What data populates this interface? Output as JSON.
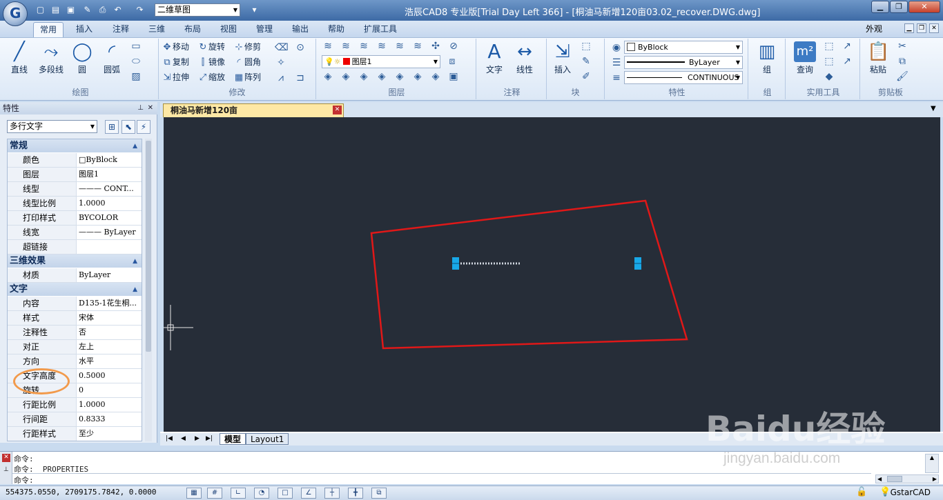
{
  "window": {
    "title": "浩辰CAD8 专业版[Trial Day Left 366] - [桐油马新增120亩03.02_recover.DWG.dwg]",
    "workspace": "二维草图",
    "appearance": "外观"
  },
  "tabs": [
    "常用",
    "插入",
    "注释",
    "三维",
    "布局",
    "视图",
    "管理",
    "输出",
    "帮助",
    "扩展工具"
  ],
  "ribbon": {
    "draw": {
      "label": "绘图",
      "line": "直线",
      "polyline": "多段线",
      "circle": "圆",
      "arc": "圆弧"
    },
    "modify": {
      "label": "修改",
      "move": "移动",
      "rotate": "旋转",
      "trim": "修剪",
      "copy": "复制",
      "mirror": "镜像",
      "fillet": "圆角",
      "stretch": "拉伸",
      "scale": "缩放",
      "array": "阵列"
    },
    "layers": {
      "label": "图层",
      "current": "图层1"
    },
    "annotation": {
      "label": "注释",
      "text": "文字",
      "dimension": "线性"
    },
    "block": {
      "label": "块",
      "insert": "插入"
    },
    "properties": {
      "label": "特性",
      "color": "ByBlock",
      "lineweight": "ByLayer",
      "linetype": "CONTINUOUS"
    },
    "group": {
      "label": "组",
      "group": "组"
    },
    "utilities": {
      "label": "实用工具",
      "query": "查询"
    },
    "clipboard": {
      "label": "剪贴板",
      "paste": "粘贴"
    }
  },
  "properties_panel": {
    "title": "特性",
    "object_type": "多行文字",
    "sections": [
      {
        "name": "常规",
        "rows": [
          {
            "key": "颜色",
            "value": "□ByBlock"
          },
          {
            "key": "图层",
            "value": "图层1"
          },
          {
            "key": "线型",
            "value": "——— CONT..."
          },
          {
            "key": "线型比例",
            "value": "1.0000"
          },
          {
            "key": "打印样式",
            "value": "BYCOLOR"
          },
          {
            "key": "线宽",
            "value": "——— ByLayer"
          },
          {
            "key": "超链接",
            "value": ""
          }
        ]
      },
      {
        "name": "三维效果",
        "rows": [
          {
            "key": "材质",
            "value": "ByLayer"
          }
        ]
      },
      {
        "name": "文字",
        "rows": [
          {
            "key": "内容",
            "value": "D135-1花生桐..."
          },
          {
            "key": "样式",
            "value": "宋体"
          },
          {
            "key": "注释性",
            "value": "否"
          },
          {
            "key": "对正",
            "value": "左上"
          },
          {
            "key": "方向",
            "value": "水平"
          },
          {
            "key": "文字高度",
            "value": "0.5000"
          },
          {
            "key": "旋转",
            "value": "0"
          },
          {
            "key": "行距比例",
            "value": "1.0000"
          },
          {
            "key": "行间距",
            "value": "0.8333"
          },
          {
            "key": "行距样式",
            "value": "至少"
          }
        ]
      }
    ]
  },
  "document_tab": "桐油马新增120亩03.02_recover.DWG.dwg",
  "layout_tabs": [
    "模型",
    "Layout1"
  ],
  "command": {
    "lines": [
      "命令:",
      "命令: _PROPERTIES",
      "命令:"
    ]
  },
  "status": {
    "coordinates": "554375.0550, 2709175.7842, 0.0000",
    "brand": "GstarCAD"
  },
  "watermark": {
    "main": "Baidu经验",
    "sub": "jingyan.baidu.com"
  },
  "colors": {
    "boundary": "#e01818",
    "grip": "#18a8e8",
    "canvas": "#262d38"
  }
}
